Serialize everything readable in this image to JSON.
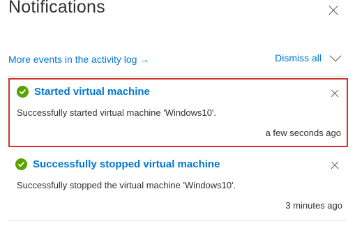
{
  "panel": {
    "title": "Notifications",
    "activity_link": "More events in the activity log →",
    "dismiss_all": "Dismiss all"
  },
  "notifications": [
    {
      "title": "Started virtual machine",
      "description": "Successfully started virtual machine 'Windows10'.",
      "time": "a few seconds ago",
      "status": "success",
      "selected": true
    },
    {
      "title": "Successfully stopped virtual machine",
      "description": "Successfully stopped the virtual machine 'Windows10'.",
      "time": "3 minutes ago",
      "status": "success",
      "selected": false
    }
  ],
  "icons": {
    "status": "check-circle-icon",
    "close": "close-icon",
    "expand": "chevron-down-icon"
  },
  "colors": {
    "link": "#0078d4",
    "success": "#57a300",
    "highlight_border": "#d32f2f"
  }
}
